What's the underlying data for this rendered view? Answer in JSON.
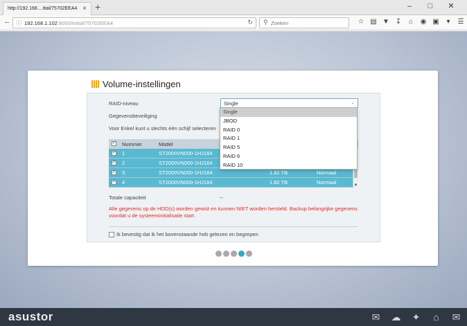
{
  "browser": {
    "tab_title": "http://192.168....itial/75702EEA4",
    "tab_close": "×",
    "new_tab": "+",
    "url_host": "192.168.1.102",
    "url_rest": ":8000/initial/75702EEA4",
    "search_placeholder": "Zoeken",
    "icons": [
      "star-icon",
      "clipboard-icon",
      "pocket-icon",
      "download-icon",
      "home-icon",
      "addon-icon",
      "addon2-icon",
      "menu-icon"
    ]
  },
  "setup": {
    "title": "Volume-instellingen",
    "raid_label": "RAID-niveau",
    "raid_selected": "Single",
    "protection_label": "Gegevensbeveiliging",
    "single_note": "Voor Enkel kunt u slechts één schijf selecteren",
    "table": {
      "col_number": "Nummer",
      "col_model": "Model",
      "rows": [
        {
          "number": "1",
          "model": "ST2000VN000-1HJ164",
          "capacity": "",
          "status": ""
        },
        {
          "number": "2",
          "model": "ST2000VN000-1HJ164",
          "capacity": "",
          "status": ""
        },
        {
          "number": "3",
          "model": "ST2000VN000-1HJ164",
          "capacity": "1.82 TB",
          "status": "Normaal"
        },
        {
          "number": "4",
          "model": "ST2000VN000-1HJ164",
          "capacity": "1.82 TB",
          "status": "Normaal"
        }
      ]
    },
    "capacity_label": "Totale capaciteit",
    "capacity_value": "--",
    "warning": "Alle gegevens op de HDD(s) worden gewist en kunnen NIET worden hersteld. Backup belangrijke gegevens voordat u de systeeminitialisatie start.",
    "confirm_label": "Ik bevestig dat ik het bovenstaande heb gelezen en begrepen",
    "raid_options": [
      "Single",
      "JBOD",
      "RAID 0",
      "RAID 1",
      "RAID 5",
      "RAID 6",
      "RAID 10"
    ],
    "step_active": 4,
    "step_count": 5
  },
  "footer": {
    "logo": "asustor",
    "icons": [
      "chat-icon",
      "cloud-icon",
      "puzzle-icon",
      "institution-icon",
      "mail-icon"
    ]
  },
  "colors": {
    "accent": "#5ab8d0",
    "warning": "#e32a20",
    "title_icon": "#f2a41a",
    "footer": "#2f3742"
  }
}
